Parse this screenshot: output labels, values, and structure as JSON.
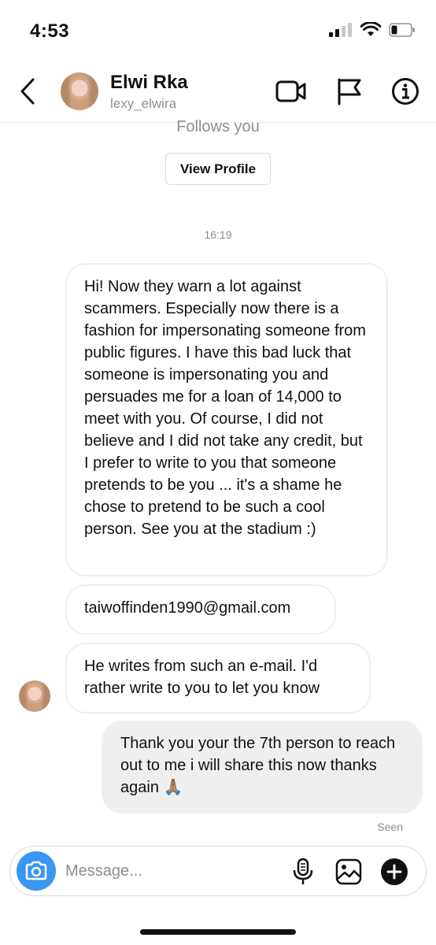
{
  "status_bar": {
    "time": "4:53"
  },
  "header": {
    "name": "Elwi Rka",
    "handle": "lexy_elwira"
  },
  "profile_card": {
    "follows_you": "Follows you",
    "view_profile": "View Profile"
  },
  "thread": {
    "timestamp": "16:19",
    "messages": [
      {
        "from": "them",
        "text": "Hi! Now they warn a lot against scammers. Especially now there is a fashion for impersonating someone from public figures. I have this bad luck that someone is impersonating you and persuades me for a loan of 14,000 to meet with you. Of course, I did not believe and I did not take any credit, but I prefer to write to you that someone pretends to be you ... it's a shame he chose to pretend to be such a cool person. See you at the stadium :)"
      },
      {
        "from": "them",
        "text": "taiwoffinden1990@gmail.com"
      },
      {
        "from": "them",
        "text": "He writes from such an e-mail. I'd rather write to you to let you know"
      },
      {
        "from": "me",
        "text": "Thank you your the 7th person to reach out to me i will share this now thanks again 🙏🏽"
      }
    ],
    "seen": "Seen"
  },
  "composer": {
    "placeholder": "Message..."
  },
  "icons": {
    "back": "chevron-left-icon",
    "video": "video-camera-icon",
    "flag": "flag-icon",
    "info": "info-icon",
    "camera": "camera-icon",
    "mic": "microphone-icon",
    "gallery": "image-icon",
    "add": "plus-circle-icon"
  },
  "colors": {
    "accent": "#3897f0",
    "outgoing_bubble": "#efefef",
    "incoming_border": "#efefef",
    "muted_text": "#8e8e8e"
  }
}
